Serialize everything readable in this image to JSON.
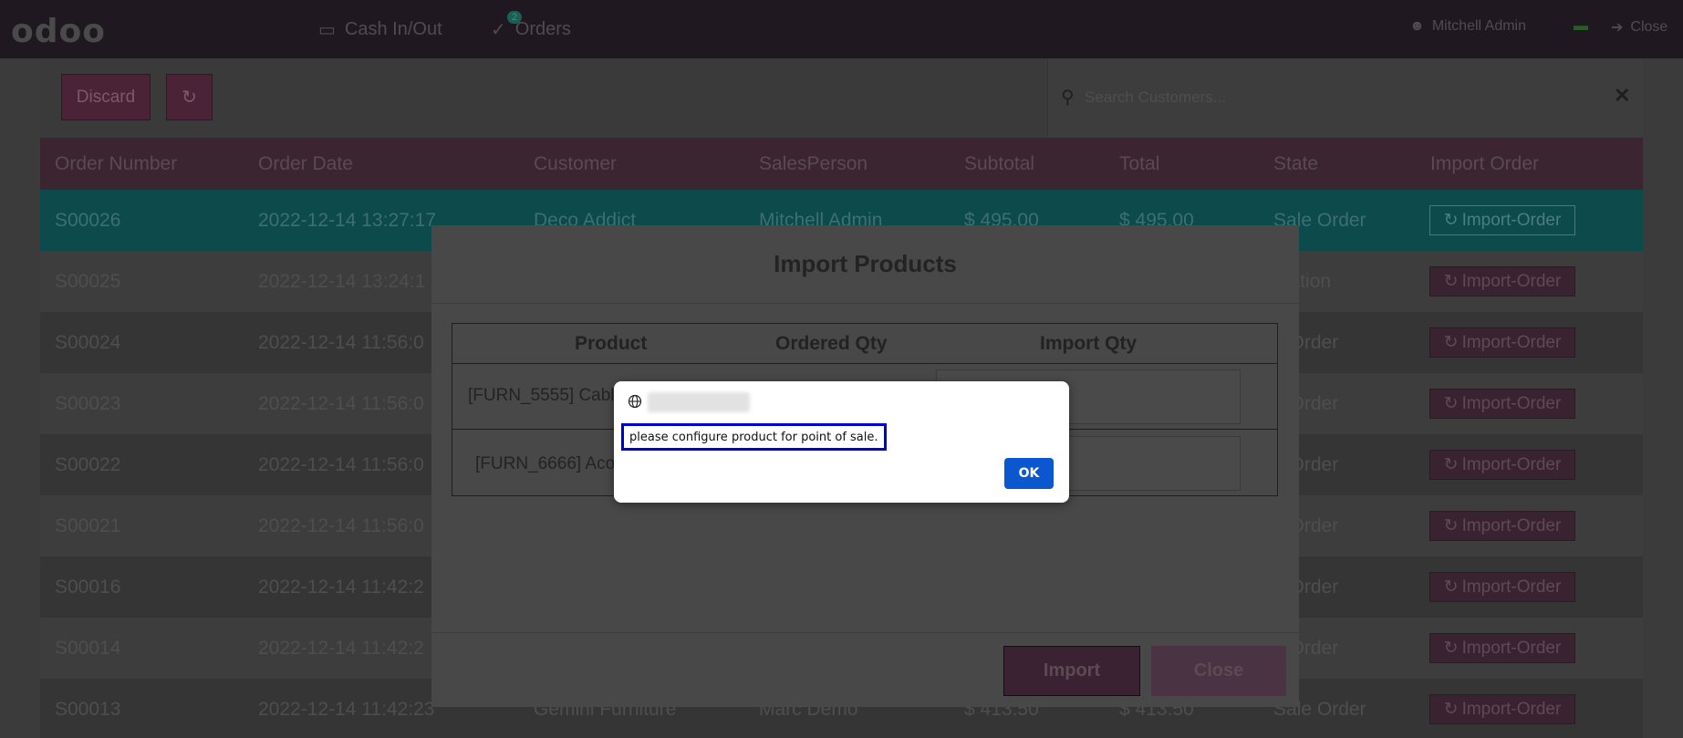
{
  "navbar": {
    "logo": "odoo",
    "cash_label": "Cash In/Out",
    "orders_label": "Orders",
    "orders_badge": "2",
    "user_name": "Mitchell Admin",
    "close_label": "Close"
  },
  "controls": {
    "discard_label": "Discard",
    "search_placeholder": "Search Customers..."
  },
  "orders_table": {
    "headers": [
      "Order Number",
      "Order Date",
      "Customer",
      "SalesPerson",
      "Subtotal",
      "Total",
      "State",
      "Import Order"
    ],
    "import_button_label": "Import-Order",
    "rows": [
      {
        "number": "S00026",
        "date": "2022-12-14 13:27:17",
        "customer": "Deco Addict",
        "salesperson": "Mitchell Admin",
        "subtotal": "$ 495.00",
        "total": "$ 495.00",
        "state": "Sale Order"
      },
      {
        "number": "S00025",
        "date": "2022-12-14 13:24:1",
        "customer": "",
        "salesperson": "",
        "subtotal": "",
        "total": "",
        "state": "otation"
      },
      {
        "number": "S00024",
        "date": "2022-12-14 11:56:0",
        "customer": "",
        "salesperson": "",
        "subtotal": "",
        "total": "",
        "state": "e Order"
      },
      {
        "number": "S00023",
        "date": "2022-12-14 11:56:0",
        "customer": "",
        "salesperson": "",
        "subtotal": "",
        "total": "",
        "state": "e Order"
      },
      {
        "number": "S00022",
        "date": "2022-12-14 11:56:0",
        "customer": "",
        "salesperson": "",
        "subtotal": "",
        "total": "",
        "state": "e Order"
      },
      {
        "number": "S00021",
        "date": "2022-12-14 11:56:0",
        "customer": "",
        "salesperson": "",
        "subtotal": "",
        "total": "",
        "state": "e Order"
      },
      {
        "number": "S00016",
        "date": "2022-12-14 11:42:2",
        "customer": "",
        "salesperson": "",
        "subtotal": "",
        "total": "",
        "state": "e Order"
      },
      {
        "number": "S00014",
        "date": "2022-12-14 11:42:2",
        "customer": "",
        "salesperson": "",
        "subtotal": "",
        "total": "",
        "state": "e Order"
      },
      {
        "number": "S00013",
        "date": "2022-12-14 11:42:23",
        "customer": "Gemini Furniture",
        "salesperson": "Marc Demo",
        "subtotal": "$ 413.50",
        "total": "$ 413.50",
        "state": "Sale Order"
      }
    ]
  },
  "import_modal": {
    "title": "Import Products",
    "headers": {
      "product": "Product",
      "ordered_qty": "Ordered Qty",
      "import_qty": "Import Qty"
    },
    "rows": [
      {
        "product": "[FURN_5555] Cable"
      },
      {
        "product": "[FURN_6666] Acou"
      }
    ],
    "import_label": "Import",
    "close_label": "Close"
  },
  "alert": {
    "message": "please configure product for point of sale.",
    "ok_label": "OK"
  }
}
